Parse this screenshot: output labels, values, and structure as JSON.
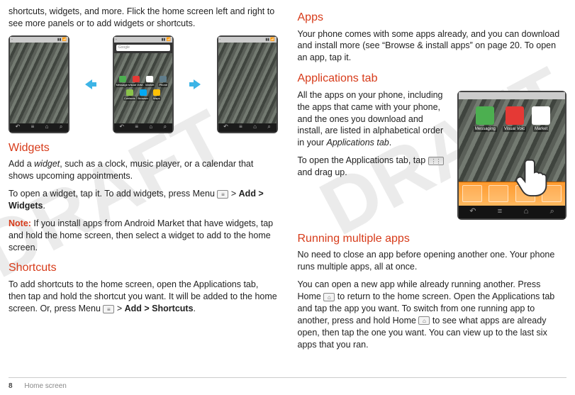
{
  "watermark": "DRAFT",
  "left": {
    "intro": "shortcuts, widgets, and more. Flick the home screen left and right to see more panels or to add widgets or shortcuts.",
    "screens": {
      "search_placeholder": "Google",
      "apps": [
        "Messaging",
        "Visual VoM..",
        "Market",
        "Phone",
        "Contacts",
        "Browser",
        "Maps"
      ]
    },
    "widgets": {
      "heading": "Widgets",
      "p1a": "Add a ",
      "p1_widget": "widget",
      "p1b": ", such as a clock, music player, or a calendar that shows upcoming appointments.",
      "p2a": "To open a widget, tap it. To add widgets, press Menu ",
      "p2b": " > ",
      "p2_bold": "Add > Widgets",
      "p2c": ".",
      "note_label": "Note:",
      "note": " If you install apps from Android Market that have widgets, tap and hold the home screen, then select a widget to add to the home screen."
    },
    "shortcuts": {
      "heading": "Shortcuts",
      "p1": "To add shortcuts to the home screen, open the Applications tab, then tap and hold the shortcut you want. It will be added to the home screen. Or, press Menu ",
      "p1b": " > ",
      "p1_bold": "Add > Shortcuts",
      "p1c": "."
    }
  },
  "right": {
    "apps": {
      "heading": "Apps",
      "p1": "Your phone comes with some apps already, and you can download and install more (see “Browse & install apps” on page 20. To open an app, tap it."
    },
    "apptab": {
      "heading": "Applications tab",
      "p1a": "All the apps on your phone, including the apps that came with your phone, and the ones you download and install, are listed in alphabetical order in your ",
      "p1_ital": "Applications tab",
      "p1b": ".",
      "p2a": "To open the Applications tab, tap ",
      "p2b": " and drag up.",
      "fig_apps": [
        "Messaging",
        "Visual Voic",
        "Market"
      ]
    },
    "multi": {
      "heading": "Running multiple apps",
      "p1": "No need to close an app before opening another one. Your phone runs multiple apps, all at once.",
      "p2a": "You can open a new app while already running another. Press Home ",
      "p2b": " to return to the home screen. Open the Applications tab and tap the app you want. To switch from one running app to another, press and hold Home ",
      "p2c": " to see what apps are already open, then tap the one you want. You can view up to the last six apps that you ran."
    }
  },
  "footer": {
    "page": "8",
    "section": "Home screen"
  }
}
